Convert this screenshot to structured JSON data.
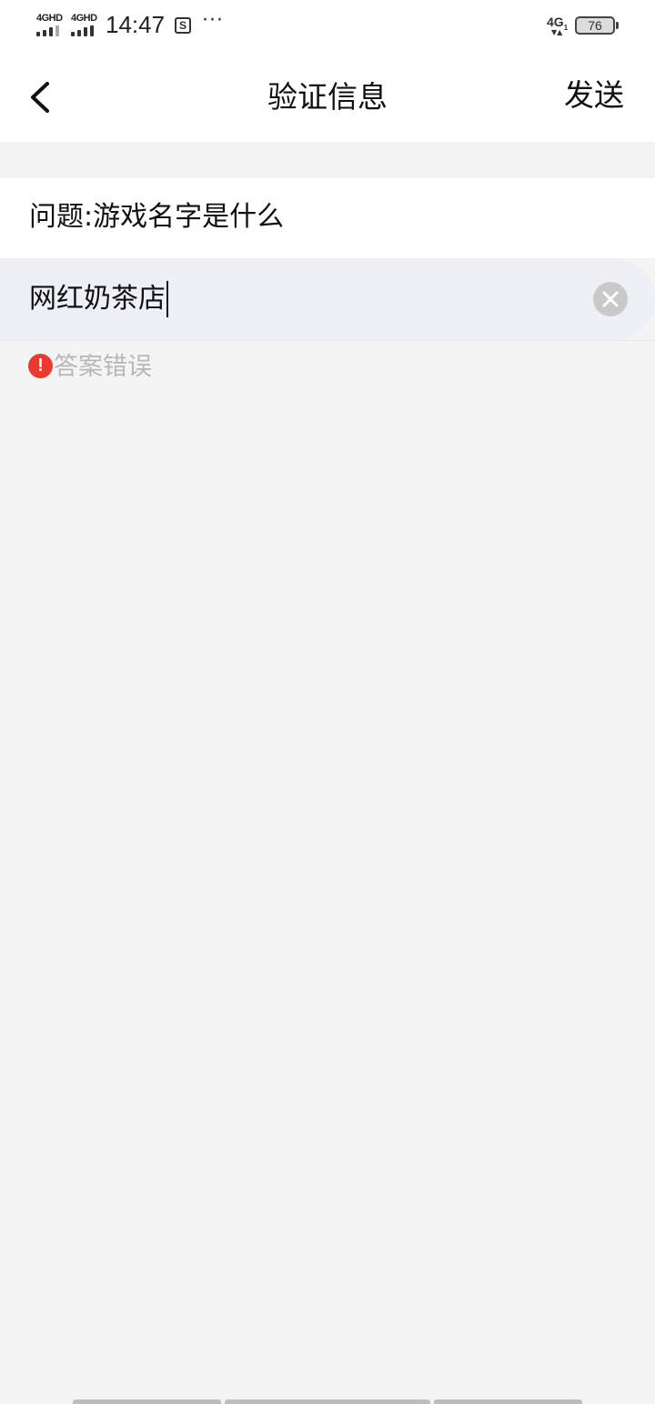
{
  "status_bar": {
    "network_1": "4GHD",
    "network_2": "4GHD",
    "time": "14:47",
    "more_indicator": "···",
    "network_right": "4G",
    "network_right_sub": "1",
    "battery_level": "76"
  },
  "nav": {
    "back_icon": "chevron-left-icon",
    "title": "验证信息",
    "send_label": "发送"
  },
  "question": {
    "text": "问题:游戏名字是什么"
  },
  "answer": {
    "value": "网红奶茶店",
    "clear_icon": "close-circle-icon"
  },
  "error": {
    "icon": "exclamation-icon",
    "icon_glyph": "!",
    "message": "答案错误",
    "color": "#ea3a2e"
  }
}
